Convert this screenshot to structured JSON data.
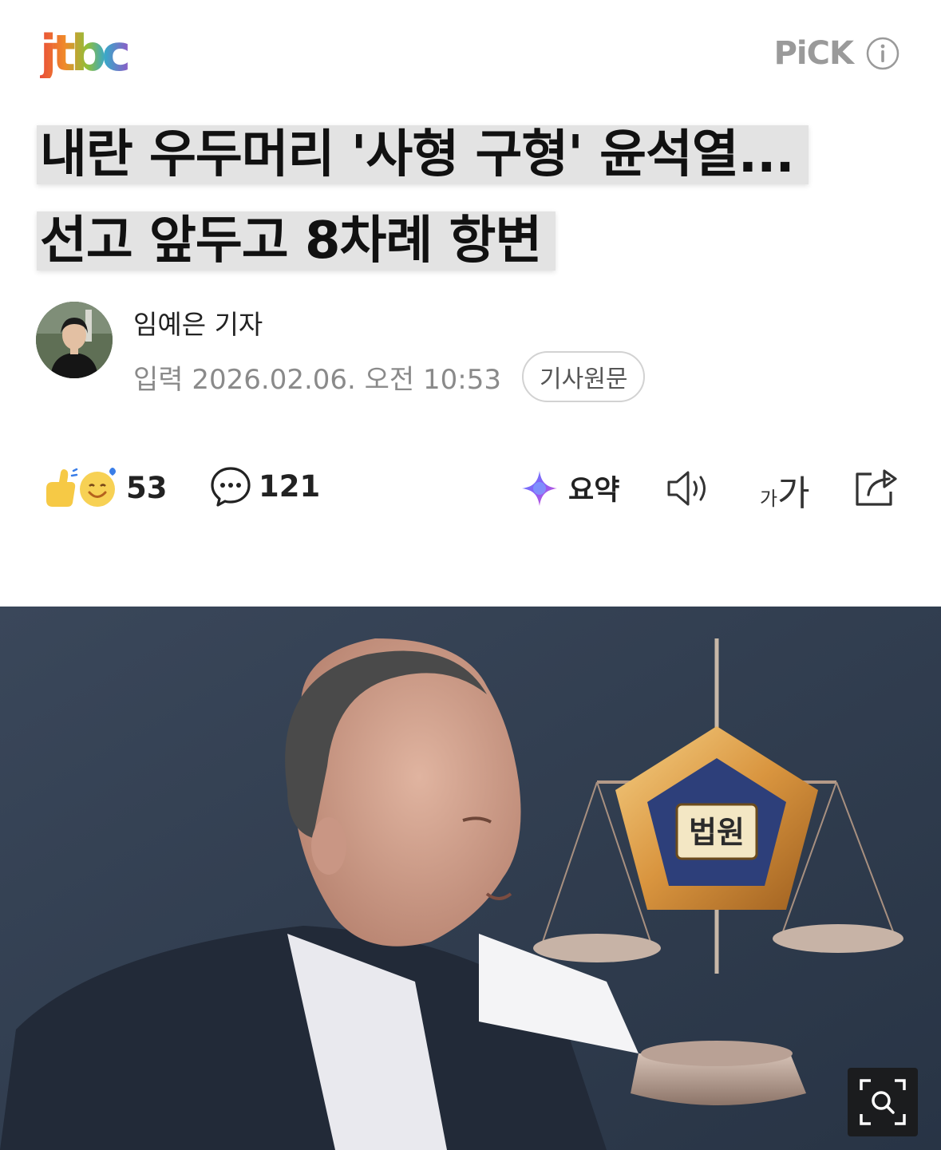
{
  "header": {
    "logo": "jtbc",
    "pick_label": "PiCK",
    "info_icon": "info-icon"
  },
  "article": {
    "headline": "내란 우두머리 '사형 구형' 윤석열... 선고 앞두고 8차례 항변",
    "reporter": "임예은 기자",
    "date": "입력 2026.02.06. 오전 10:53",
    "source_button": "기사원문"
  },
  "toolbar": {
    "reaction_count": "53",
    "comment_count": "121",
    "summary_label": "요약",
    "font_size_small": "가",
    "font_size_large": "가",
    "icons": [
      "reaction-emoji-icon",
      "comment-icon",
      "summary-sparkle-icon",
      "speaker-icon",
      "font-size-icon",
      "share-icon"
    ]
  },
  "photo": {
    "court_emblem_text": "법원",
    "zoom_icon": "zoom-search-icon"
  }
}
